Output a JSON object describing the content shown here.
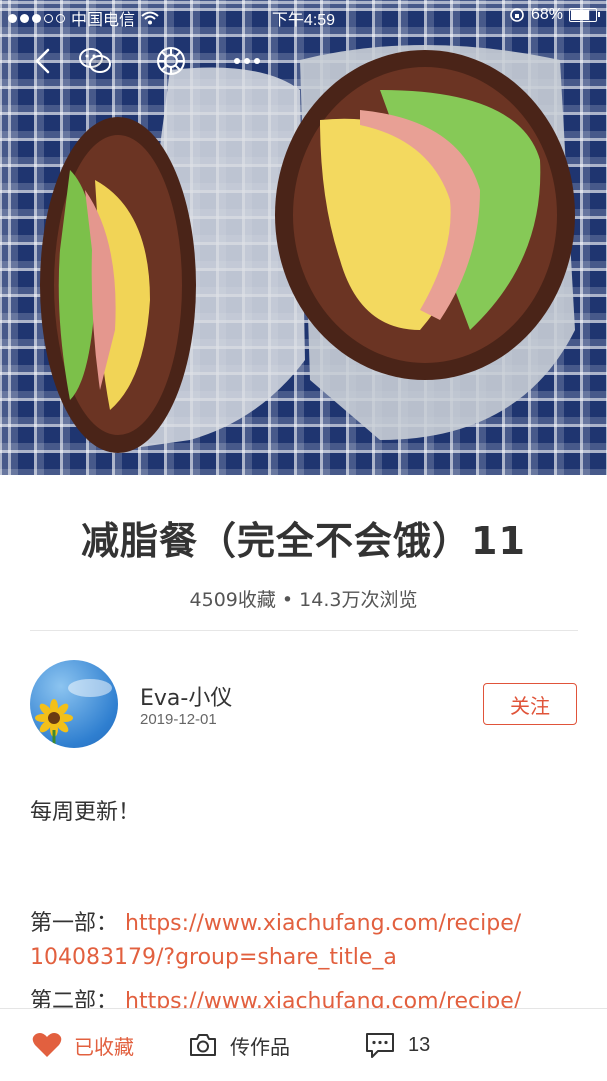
{
  "status_bar": {
    "carrier": "中国电信",
    "time": "下午4:59",
    "battery": "68%",
    "battery_level": 0.68
  },
  "nav": {
    "icons": [
      "back-icon",
      "wechat-icon",
      "moments-icon",
      "more-icon"
    ]
  },
  "recipe": {
    "title": "减脂餐（完全不会饿）11",
    "stats": "4509收藏 • 14.3万次浏览"
  },
  "author": {
    "name": "Eva-小仪",
    "date": "2019-12-01",
    "follow_label": "关注"
  },
  "body": {
    "intro": "每周更新！",
    "part1_label": "第一部：",
    "part1_url_line1": "https://www.xiachufang.com/recipe/",
    "part1_url_line2": "104083179/?group=share_title_a",
    "part2_label": "第二部：",
    "part2_url_line1": "https://www.xiachufang.com/recipe/"
  },
  "bottom_bar": {
    "favorite_label": "已收藏",
    "upload_label": "传作品",
    "comment_count": "13"
  },
  "colors": {
    "accent": "#e2603f",
    "text": "#333333"
  }
}
